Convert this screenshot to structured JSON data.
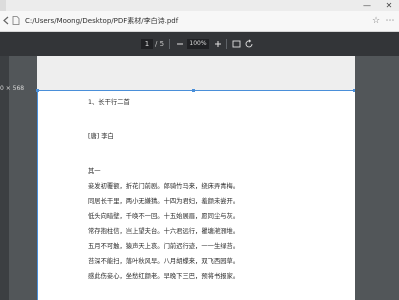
{
  "window": {
    "minimize_glyph": "—",
    "close_glyph": "✕"
  },
  "address_bar": {
    "url": "C:/Users/Moong/Desktop/PDF素材/李白诗.pdf"
  },
  "pdf_toolbar": {
    "current_page": "1",
    "page_total": "/ 5",
    "zoom": "100%"
  },
  "viewer": {
    "size_readout": "0 × 568"
  },
  "document": {
    "heading": "1、长干行二首",
    "author": "[唐] 李白",
    "section": "其一",
    "lines": [
      "妾发初覆额，折花门前剧。郎骑竹马来，绕床弄青梅。",
      "同居长干里，两小无嫌猜。十四为君妇，羞颜未尝开。",
      "低头向暗壁，千唤不一回。十五始展眉，愿同尘与灰。",
      "常存抱柱信，岂上望夫台。十六君远行，瞿塘滟滪堆。",
      "五月不可触，猿声天上哀。门前迟行迹，一一生绿苔。",
      "苔深不能扫，落叶秋风早。八月胡蝶来，双飞西园草。",
      "感此伤妾心，坐愁红颜老。早晚下三巴，预将书报家。"
    ]
  },
  "colors": {
    "toolbar_bg": "#333538",
    "viewer_bg": "#525659",
    "selection": "#4a8fd9"
  }
}
